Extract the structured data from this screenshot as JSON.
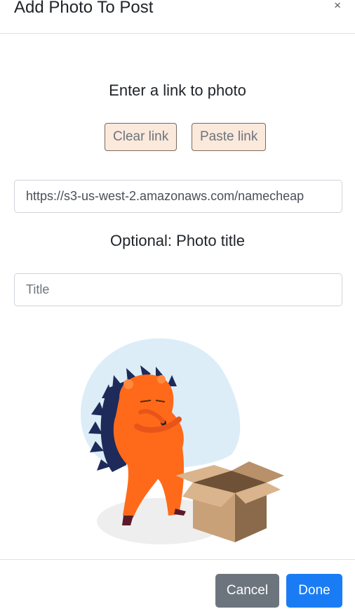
{
  "modal": {
    "title": "Add Photo To Post",
    "close_glyph": "×"
  },
  "link_section": {
    "heading": "Enter a link to photo",
    "clear_label": "Clear link",
    "paste_label": "Paste link",
    "url_value": "https://s3-us-west-2.amazonaws.com/namecheap"
  },
  "title_section": {
    "heading": "Optional: Photo title",
    "placeholder": "Title",
    "value": ""
  },
  "footer": {
    "cancel_label": "Cancel",
    "done_label": "Done"
  },
  "colors": {
    "primary": "#1a7cf5",
    "secondary": "#6c757d",
    "link_button_bg": "#fbe9dc",
    "illustration_circle": "#dcedf8",
    "hedgehog_body": "#ff6a1a",
    "box": "#c8a178"
  }
}
